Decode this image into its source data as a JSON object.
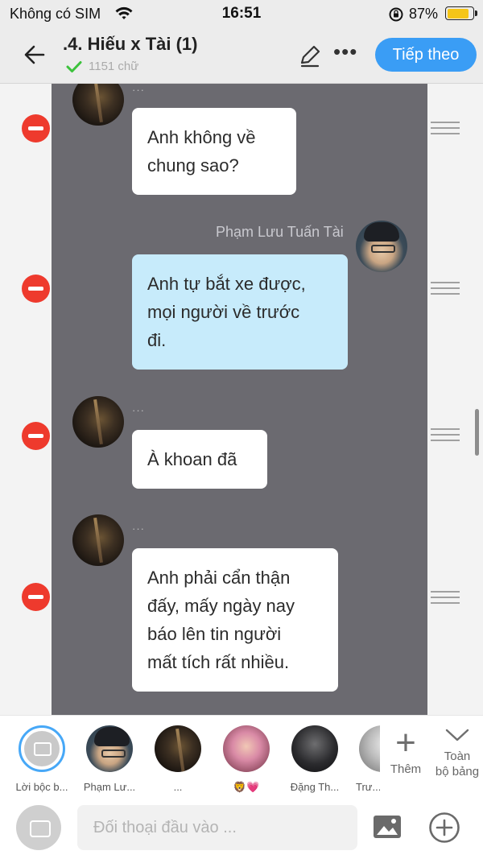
{
  "status_bar": {
    "carrier": "Không có SIM",
    "time": "16:51",
    "battery_percent": "87%",
    "battery_level": 0.87,
    "wifi_icon": "wifi-icon",
    "rotation_lock_icon": "rotation-lock-icon"
  },
  "header": {
    "title": ".4. Hiếu x Tài (1)",
    "word_count": "1151 chữ",
    "next_label": "Tiếp theo",
    "more_label": "•••",
    "accent_color": "#3a9df5",
    "check_color": "#3cc23c"
  },
  "chat": {
    "messages": [
      {
        "side": "left",
        "speaker": "",
        "text": "Anh không về\nchung sao?"
      },
      {
        "side": "right",
        "speaker": "Phạm Lưu Tuấn Tài",
        "text": "Anh tự bắt xe được,\nmọi người về trước\nđi."
      },
      {
        "side": "left",
        "speaker": "",
        "text": "À khoan đã"
      },
      {
        "side": "left",
        "speaker": "",
        "text": "Anh phải cẩn thận\nđấy, mấy ngày nay\nbáo lên tin người\nmất tích rất nhiều."
      }
    ],
    "speaker_placeholder": "···"
  },
  "characters": {
    "items": [
      {
        "label": "Lời bộc b...",
        "selected": true
      },
      {
        "label": "Phạm Lư..."
      },
      {
        "label": "..."
      },
      {
        "label": "🦁💗"
      },
      {
        "label": "Đặng Th..."
      },
      {
        "label": "Trư..."
      }
    ],
    "add_label": "Thêm",
    "board_label": "Toàn\nbộ bảng"
  },
  "composer": {
    "placeholder": "Đối thoại đầu vào ..."
  }
}
